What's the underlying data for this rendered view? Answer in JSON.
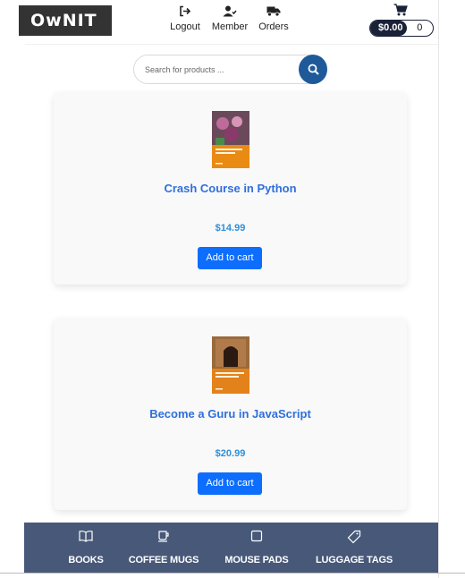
{
  "brand": {
    "logo_text": "OwNIT"
  },
  "nav": {
    "logout": "Logout",
    "member": "Member",
    "orders": "Orders"
  },
  "cart": {
    "total": "$0.00",
    "count": "0"
  },
  "search": {
    "placeholder": "Search for products ..."
  },
  "products": [
    {
      "title": "Crash Course in Python",
      "price": "$14.99",
      "button": "Add to cart",
      "cover_text": "Crash Course in Python"
    },
    {
      "title": "Become a Guru in JavaScript",
      "price": "$20.99",
      "button": "Add to cart",
      "cover_text": "Become a Guru in JavaScript"
    }
  ],
  "categories": [
    {
      "label": "BOOKS",
      "icon": "book-icon"
    },
    {
      "label": "COFFEE MUGS",
      "icon": "mug-icon"
    },
    {
      "label": "MOUSE PADS",
      "icon": "square-icon"
    },
    {
      "label": "LUGGAGE TAGS",
      "icon": "tag-icon"
    }
  ],
  "colors": {
    "accent": "#0d6efd",
    "title_blue": "#2f6fdc",
    "price_blue": "#2f8fd8",
    "category_bar": "#485878",
    "search_button": "#1e5a99",
    "cart_dark": "#1a2238"
  }
}
